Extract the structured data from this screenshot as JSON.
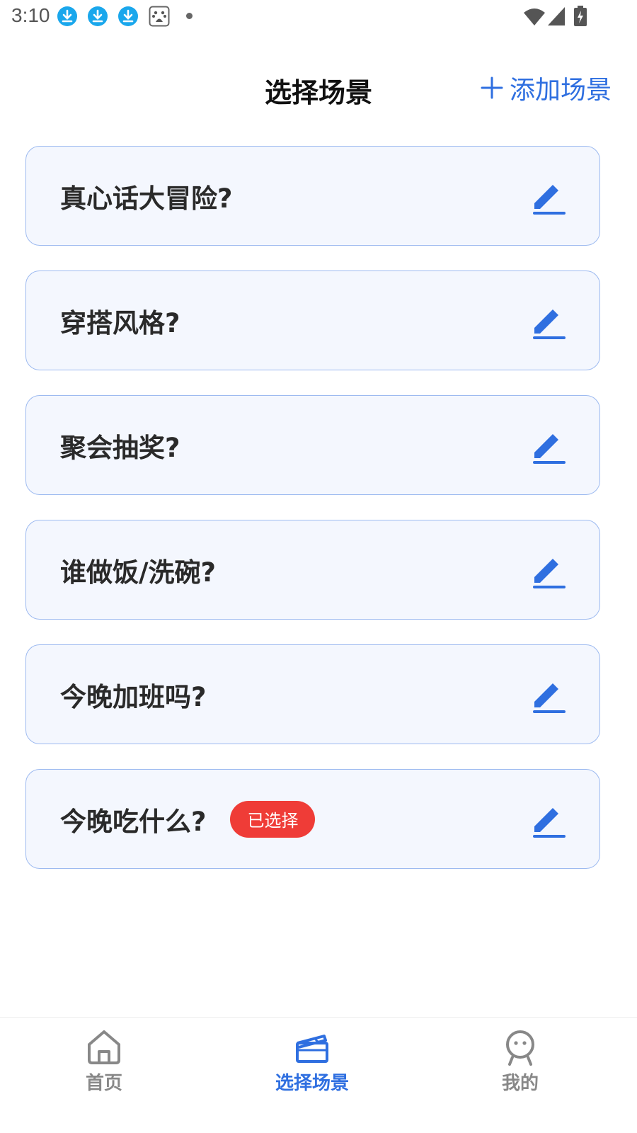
{
  "status_bar": {
    "time": "3:10",
    "notification_icons": [
      "download-icon",
      "download-icon",
      "download-icon",
      "baidu-icon"
    ],
    "system_icons": [
      "wifi-icon",
      "signal-icon",
      "battery-icon"
    ]
  },
  "header": {
    "title": "选择场景",
    "add_label": "添加场景",
    "accent_color": "#2f6fe0"
  },
  "scenes": [
    {
      "label": "真心话大冒险?",
      "selected": false
    },
    {
      "label": "穿搭风格?",
      "selected": false
    },
    {
      "label": "聚会抽奖?",
      "selected": false
    },
    {
      "label": "谁做饭/洗碗?",
      "selected": false
    },
    {
      "label": "今晚加班吗?",
      "selected": false
    },
    {
      "label": "今晚吃什么?",
      "selected": true,
      "badge": "已选择"
    }
  ],
  "colors": {
    "card_border": "#9dbaf0",
    "card_background": "#f4f7fe",
    "badge": "#ef3c37",
    "inactive_nav": "#888888"
  },
  "bottom_nav": {
    "items": [
      {
        "label": "首页",
        "icon": "home-icon",
        "active": false
      },
      {
        "label": "选择场景",
        "icon": "clapperboard-icon",
        "active": true
      },
      {
        "label": "我的",
        "icon": "profile-icon",
        "active": false
      }
    ]
  }
}
